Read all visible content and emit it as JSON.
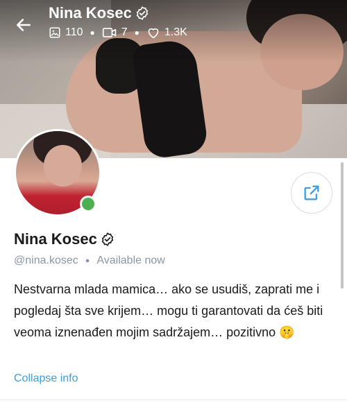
{
  "header": {
    "name": "Nina Kosec",
    "stats": {
      "images": "110",
      "videos": "7",
      "likes": "1.3K"
    }
  },
  "profile": {
    "name": "Nina Kosec",
    "handle": "@nina.kosec",
    "status": "Available now",
    "bio": "Nestvarna mlada mamica… ako se usudiš, zaprati me i pogledaj šta sve krijem… mogu ti garantovati da ćeš biti veoma iznenađen mojim sadržajem… pozitivno 🤫",
    "collapse_label": "Collapse info"
  },
  "colors": {
    "accent": "#3b9fe0",
    "online": "#4caf50",
    "muted": "#8a96a3"
  },
  "icons": [
    "back-arrow-icon",
    "verified-icon",
    "image-icon",
    "video-icon",
    "heart-icon",
    "share-icon"
  ]
}
